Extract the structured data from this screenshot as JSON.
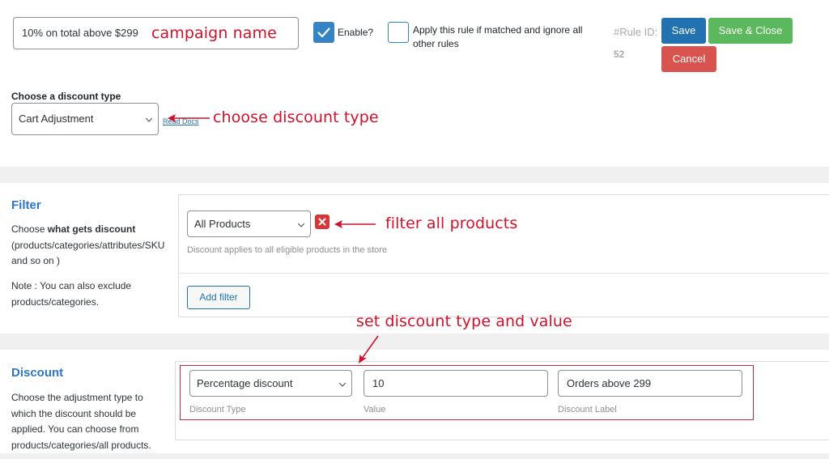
{
  "rule": {
    "campaign_name_value": "10% on total above $299",
    "enable_label": "Enable?",
    "enable_checked": true,
    "apply_rule_label": "Apply this rule if matched and ignore all other rules",
    "apply_rule_checked": false,
    "rule_id_label": "#Rule ID:",
    "rule_id_value": "52",
    "save_label": "Save",
    "save_close_label": "Save & Close",
    "cancel_label": "Cancel"
  },
  "discount_type": {
    "heading": "Choose a discount type",
    "selected": "Cart Adjustment",
    "read_docs": "Read Docs"
  },
  "filter": {
    "title": "Filter",
    "help_prefix": "Choose ",
    "help_bold": "what gets discount",
    "help_rest": "(products/categories/attributes/SKU and so on )",
    "note": "Note : You can also exclude products/categories.",
    "selected": "All Products",
    "hint": "Discount applies to all eligible products in the store",
    "add_filter_label": "Add filter"
  },
  "discount": {
    "title": "Discount",
    "help": "Choose the adjustment type to which the discount should be applied. You can choose from products/categories/all products.",
    "type_selected": "Percentage discount",
    "type_caption": "Discount Type",
    "value": "10",
    "value_caption": "Value",
    "label_value": "Orders above 299",
    "label_caption": "Discount Label"
  },
  "annotations": {
    "campaign_name": "campaign name",
    "choose_discount_type": "choose discount type",
    "filter_all_products": "filter all products",
    "set_discount": "set discount type and value"
  },
  "colors": {
    "annotation_red": "#d0112b",
    "save_blue": "#2271b1",
    "save_close_green": "#5cb85c",
    "cancel_red": "#d9534f",
    "title_blue": "#2c76c7"
  }
}
